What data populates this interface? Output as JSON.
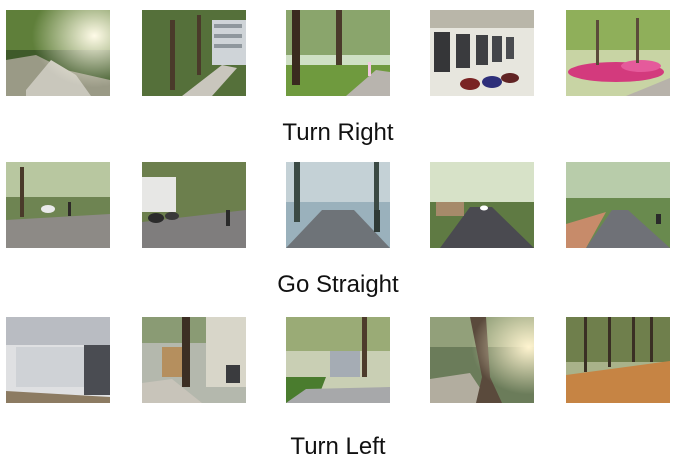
{
  "groups": [
    {
      "label": "Turn Right",
      "thumbnails": [
        {
          "scene": "trees-hill-sunlit"
        },
        {
          "scene": "trees-path-building"
        },
        {
          "scene": "tree-trunks-lawn-walkway"
        },
        {
          "scene": "arcade-building-parked-bikes"
        },
        {
          "scene": "pink-flowers-trees"
        }
      ]
    },
    {
      "label": "Go Straight",
      "thumbnails": [
        {
          "scene": "road-parked-car"
        },
        {
          "scene": "road-white-building-bikes"
        },
        {
          "scene": "misty-road-trees"
        },
        {
          "scene": "road-trees-cars"
        },
        {
          "scene": "road-trees-sidewalk"
        }
      ]
    },
    {
      "label": "Turn Left",
      "thumbnails": [
        {
          "scene": "blurred-building-wall"
        },
        {
          "scene": "tree-building-sidewalk"
        },
        {
          "scene": "trees-house-hedge"
        },
        {
          "scene": "large-tree-sunflare"
        },
        {
          "scene": "bamboo-trees-wall"
        }
      ]
    }
  ]
}
